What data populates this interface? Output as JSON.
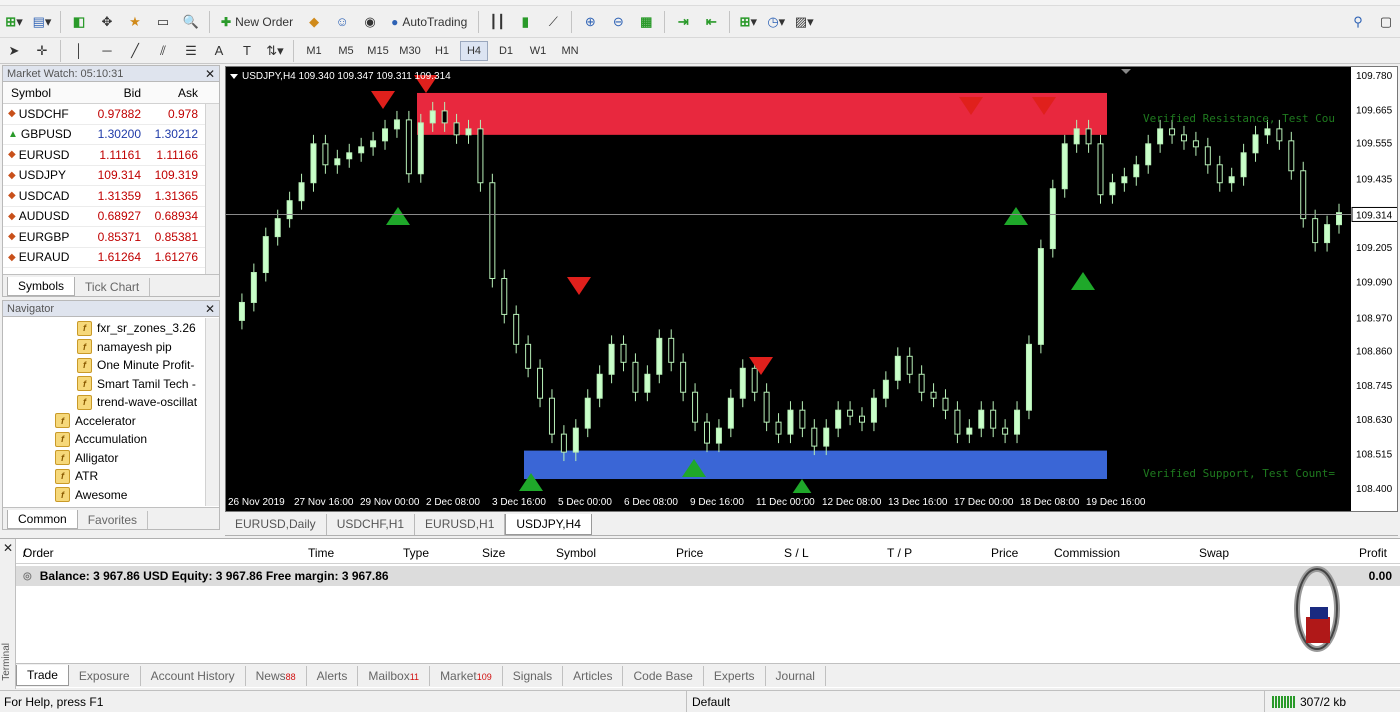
{
  "toolbar": {
    "new_order": "New Order",
    "autotrading": "AutoTrading",
    "timeframes": [
      "M1",
      "M5",
      "M15",
      "M30",
      "H1",
      "H4",
      "D1",
      "W1",
      "MN"
    ],
    "active_timeframe": "H4"
  },
  "market_watch": {
    "title": "Market Watch: 05:10:31",
    "columns": {
      "symbol": "Symbol",
      "bid": "Bid",
      "ask": "Ask"
    },
    "rows": [
      {
        "symbol": "USDCHF",
        "bid": "0.97882",
        "ask": "0.978",
        "dir": "down",
        "color": "red"
      },
      {
        "symbol": "GBPUSD",
        "bid": "1.30200",
        "ask": "1.30212",
        "dir": "up",
        "color": "blue"
      },
      {
        "symbol": "EURUSD",
        "bid": "1.11161",
        "ask": "1.11166",
        "dir": "down",
        "color": "red"
      },
      {
        "symbol": "USDJPY",
        "bid": "109.314",
        "ask": "109.319",
        "dir": "down",
        "color": "red"
      },
      {
        "symbol": "USDCAD",
        "bid": "1.31359",
        "ask": "1.31365",
        "dir": "down",
        "color": "red"
      },
      {
        "symbol": "AUDUSD",
        "bid": "0.68927",
        "ask": "0.68934",
        "dir": "down",
        "color": "red"
      },
      {
        "symbol": "EURGBP",
        "bid": "0.85371",
        "ask": "0.85381",
        "dir": "down",
        "color": "red"
      },
      {
        "symbol": "EURAUD",
        "bid": "1.61264",
        "ask": "1.61276",
        "dir": "down",
        "color": "red"
      }
    ],
    "tabs": [
      "Symbols",
      "Tick Chart"
    ]
  },
  "navigator": {
    "title": "Navigator",
    "sub_items": [
      "fxr_sr_zones_3.26",
      "namayesh pip",
      "One Minute Profit-",
      "Smart Tamil Tech -",
      "trend-wave-oscillat"
    ],
    "items": [
      "Accelerator",
      "Accumulation",
      "Alligator",
      "ATR",
      "Awesome"
    ],
    "tabs": [
      "Common",
      "Favorites"
    ]
  },
  "chart": {
    "header": "USDJPY,H4  109.340 109.347 109.311 109.314",
    "price_labels": [
      "109.780",
      "109.665",
      "109.555",
      "109.435",
      "109.314",
      "109.205",
      "109.090",
      "108.970",
      "108.860",
      "108.745",
      "108.630",
      "108.515",
      "108.400"
    ],
    "current_price": "109.314",
    "date_labels": [
      "26 Nov 2019",
      "27 Nov 16:00",
      "29 Nov 00:00",
      "2 Dec 08:00",
      "3 Dec 16:00",
      "5 Dec 00:00",
      "6 Dec 08:00",
      "9 Dec 16:00",
      "11 Dec 00:00",
      "12 Dec 08:00",
      "13 Dec 16:00",
      "17 Dec 00:00",
      "18 Dec 08:00",
      "19 Dec 16:00"
    ],
    "resistance_label": "Verified Resistance, Test Cou",
    "support_label": "Verified Support, Test Count=",
    "colors": {
      "resistance": "#e8283e",
      "support": "#3a66d6",
      "candle": "#c9ffc9",
      "bg": "#000000"
    }
  },
  "chart_tabs": {
    "items": [
      "EURUSD,Daily",
      "USDCHF,H1",
      "EURUSD,H1",
      "USDJPY,H4"
    ],
    "active": "USDJPY,H4"
  },
  "terminal": {
    "columns": [
      "Order",
      "Time",
      "Type",
      "Size",
      "Symbol",
      "Price",
      "S / L",
      "T / P",
      "Price",
      "Commission",
      "Swap",
      "Profit"
    ],
    "balance_text": "Balance: 3 967.86 USD  Equity: 3 967.86  Free margin: 3 967.86",
    "profit": "0.00",
    "side_label": "Terminal",
    "tabs": [
      {
        "label": "Trade",
        "badge": ""
      },
      {
        "label": "Exposure",
        "badge": ""
      },
      {
        "label": "Account History",
        "badge": ""
      },
      {
        "label": "News",
        "badge": "88"
      },
      {
        "label": "Alerts",
        "badge": ""
      },
      {
        "label": "Mailbox",
        "badge": "11"
      },
      {
        "label": "Market",
        "badge": "109"
      },
      {
        "label": "Signals",
        "badge": ""
      },
      {
        "label": "Articles",
        "badge": ""
      },
      {
        "label": "Code Base",
        "badge": ""
      },
      {
        "label": "Experts",
        "badge": ""
      },
      {
        "label": "Journal",
        "badge": ""
      }
    ]
  },
  "status": {
    "help": "For Help, press F1",
    "profile": "Default",
    "traffic": "307/2 kb"
  }
}
